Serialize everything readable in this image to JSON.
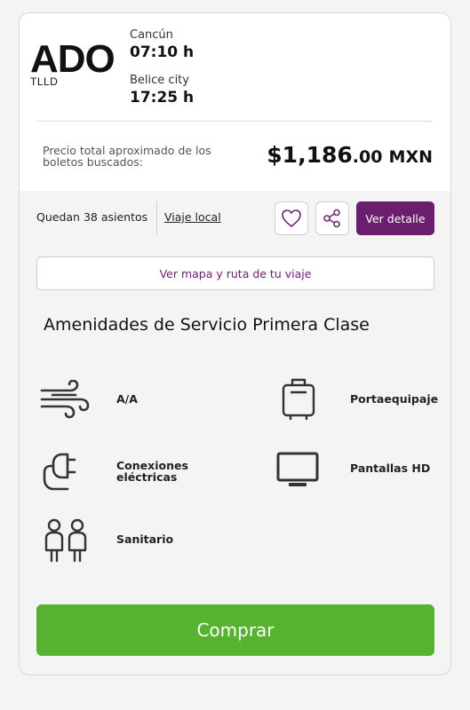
{
  "operator": {
    "logo": "ADO",
    "service_code": "TLLD"
  },
  "trip": {
    "origin": {
      "city": "Cancún",
      "time": "07:10 h"
    },
    "destination": {
      "city": "Belice city",
      "time": "17:25 h"
    }
  },
  "price": {
    "label": "Precio total aproximado de los boletos buscados:",
    "whole": "$1,186",
    "cents": ".00",
    "currency": "MXN"
  },
  "availability": {
    "seats_text": "Quedan 38 asientos",
    "trip_type": "Viaje local"
  },
  "actions": {
    "favorite_icon": "heart-icon",
    "share_icon": "share-icon",
    "detail_label": "Ver detalle",
    "map_label": "Ver mapa y ruta de tu viaje",
    "buy_label": "Comprar"
  },
  "amenities": {
    "title": "Amenidades de Servicio Primera Clase",
    "items": [
      {
        "label": "A/A",
        "icon": "air-conditioning-icon"
      },
      {
        "label": "Portaequipaje",
        "icon": "luggage-icon"
      },
      {
        "label": "Conexiones eléctricas",
        "icon": "power-plug-icon"
      },
      {
        "label": "Pantallas HD",
        "icon": "tv-screen-icon"
      },
      {
        "label": "Sanitario",
        "icon": "restroom-icon"
      }
    ]
  },
  "colors": {
    "accent": "#6b1d6e",
    "buy": "#56b330",
    "card_bg": "#f4f4f4"
  }
}
